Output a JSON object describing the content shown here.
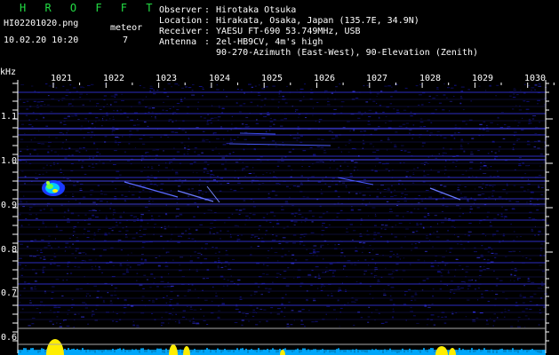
{
  "header": {
    "brand": "H R O F F T",
    "file": "HI02201020.png",
    "count_label": "meteor",
    "datetime": "10.02.20 10:20",
    "count": "7",
    "info": [
      {
        "label": "Observer",
        "value": "Hirotaka Otsuka"
      },
      {
        "label": "Location",
        "value": "Hirakata, Osaka, Japan (135.7E, 34.9N)"
      },
      {
        "label": "Receiver",
        "value": "YAESU FT-690 53.749MHz, USB"
      },
      {
        "label": "Antenna",
        "value": "2el-HB9CV, 4m's high"
      }
    ],
    "antenna_line2": "90-270-Azimuth (East-West), 90-Elevation (Zenith)"
  },
  "axes": {
    "y_unit": "kHz",
    "x_ticks": [
      "1021",
      "1022",
      "1023",
      "1024",
      "1025",
      "1026",
      "1027",
      "1028",
      "1029",
      "1030"
    ],
    "y_ticks": [
      "1.1",
      "1.0",
      "0.9",
      "0.8",
      "0.7",
      "0.6"
    ]
  },
  "colors": {
    "background": "#000000",
    "header_text": "#ffffff",
    "brand": "#22dd44",
    "axis": "#ffffff",
    "spectrum_line": "#3a3aff",
    "noise": "#1515a0",
    "activity": "#ffee00",
    "baseline": "#00aaff"
  }
}
